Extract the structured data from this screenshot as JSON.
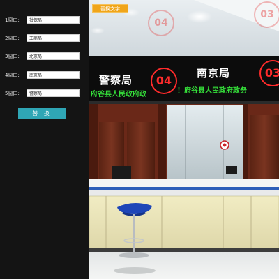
{
  "panel": {
    "rows": [
      {
        "label": "1窗口:",
        "value": "社保局"
      },
      {
        "label": "2窗口:",
        "value": "工商局"
      },
      {
        "label": "3窗口:",
        "value": "北京局"
      },
      {
        "label": "4窗口:",
        "value": "南京局"
      },
      {
        "label": "5窗口:",
        "value": "警察局"
      }
    ],
    "replace_label": "替 换"
  },
  "scene": {
    "tag_label": "替换文字",
    "signs": [
      {
        "name": "警察局",
        "number": "04",
        "scroll": "府谷县人民政府政"
      },
      {
        "name": "南京局",
        "number": "03",
        "scroll": "！府谷县人民政府政务"
      }
    ],
    "bg_numbers": [
      "04",
      "03"
    ]
  },
  "colors": {
    "accent": "#2fa6b5",
    "tag": "#f0a51a",
    "led_red": "#ff2b2b",
    "led_green": "#35e03a"
  }
}
